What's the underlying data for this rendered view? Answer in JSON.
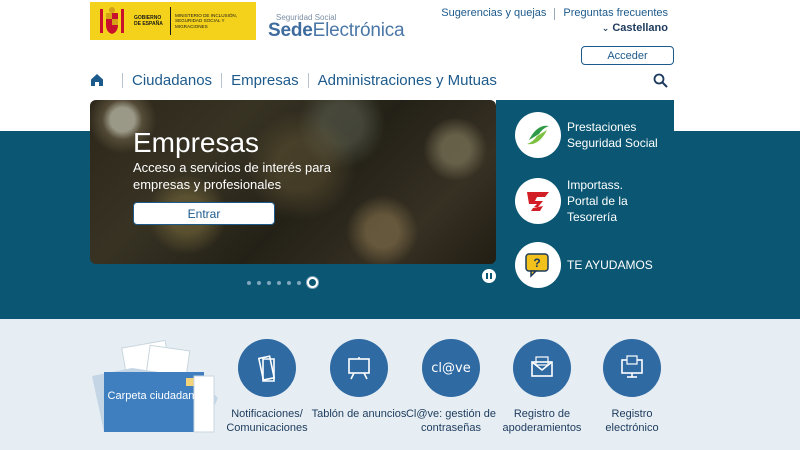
{
  "header": {
    "gov_line1": "GOBIERNO DE ESPAÑA",
    "gov_line2": "MINISTERIO DE INCLUSIÓN, SEGURIDAD SOCIAL Y MIGRACIONES",
    "sede_small": "Seguridad Social",
    "sede_bold": "Sede",
    "sede_rest": "Electrónica",
    "links": [
      "Sugerencias y quejas",
      "Preguntas frecuentes"
    ],
    "language": "Castellano",
    "login_label": "Acceder"
  },
  "nav": {
    "items": [
      "Ciudadanos",
      "Empresas",
      "Administraciones y Mutuas"
    ]
  },
  "hero": {
    "title": "Empresas",
    "subtitle": "Acceso a servicios de interés para empresas y profesionales",
    "button": "Entrar",
    "slide_count": 7,
    "active_slide": 7
  },
  "side_links": [
    {
      "label": "Prestaciones Seguridad Social",
      "icon": "prestaciones-icon"
    },
    {
      "label": "Importass. Portal de la Tesorería",
      "icon": "importass-icon"
    },
    {
      "label": "TE AYUDAMOS",
      "icon": "help-chat-icon"
    }
  ],
  "carpeta": {
    "label": "Carpeta ciudadana"
  },
  "services": [
    {
      "label": "Notificaciones/ Comunicaciones",
      "icon": "notifications-icon"
    },
    {
      "label": "Tablón de anuncios",
      "icon": "board-icon"
    },
    {
      "label": "Cl@ve: gestión de contraseñas",
      "icon": "clave-icon",
      "icon_text": "cl@ve"
    },
    {
      "label": "Registro de apoderamientos",
      "icon": "envelope-icon"
    },
    {
      "label": "Registro electrónico",
      "icon": "computer-icon"
    }
  ],
  "colors": {
    "band": "#0b5773",
    "primary": "#1d5a8c",
    "service_circle": "#2f6aa3",
    "lower_bg": "#e6eef3"
  }
}
